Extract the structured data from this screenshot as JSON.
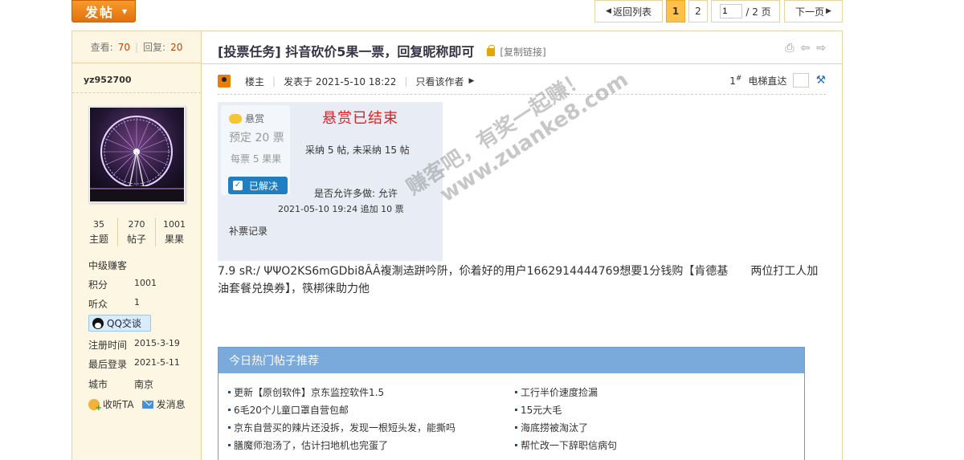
{
  "topbar": {
    "post_label": "发帖",
    "back_label": "返回列表",
    "pages": [
      "1",
      "2"
    ],
    "current_page": "1",
    "jump_value": "1",
    "jump_total": "/ 2 页",
    "next_label": "下一页"
  },
  "sidebar": {
    "views_label": "查看:",
    "views": "70",
    "replies_label": "回复:",
    "replies": "20",
    "username": "yz952700",
    "counts": [
      {
        "value": "35",
        "label": "主题"
      },
      {
        "value": "270",
        "label": "帖子"
      },
      {
        "value": "1001",
        "label": "果果"
      }
    ],
    "group": "中级赚客",
    "fields": [
      {
        "key": "积分",
        "value": "1001"
      },
      {
        "key": "听众",
        "value": "1"
      },
      {
        "key": "注册时间",
        "value": "2015-3-19"
      },
      {
        "key": "最后登录",
        "value": "2021-5-11"
      },
      {
        "key": "城市",
        "value": "南京"
      }
    ],
    "qq_label": "QQ交谈",
    "listen_label": "收听TA",
    "message_label": "发消息"
  },
  "post": {
    "title": "[投票任务] 抖音砍价5果一票，回复昵称即可",
    "copy_link": "[复制链接]",
    "author_role": "楼主",
    "posted_at": "发表于 2021-5-10 18:22",
    "only_author": "只看该作者",
    "floor_num": "1",
    "floor_sup": "#",
    "elevator_label": "电梯直达",
    "content": "7.9 sR:/ ΨΨO2KS6mGDbi8ÂÂ複淛迲跰吟阩，伱着好的用户1662914444769想要1分钱购【肯德基　　两位打工人加油套餐兑换券】，筷梆徕助力他"
  },
  "bounty": {
    "tag": "悬赏",
    "preset": "预定 20 票",
    "each": "每票 5 果果",
    "solved_label": "已解决",
    "ended": "悬赏已结束",
    "adopt": "采纳 5 帖, 未采纳 15 帖",
    "allow_multi": "是否允许多做: 允许",
    "added": "2021-05-10 19:24 追加 10 票",
    "record": "补票记录"
  },
  "watermark": {
    "line1": "赚客吧，有奖一起赚！",
    "line2": "www.zuanke8.com"
  },
  "hot": {
    "title": "今日热门帖子推荐",
    "left": [
      "更新【原创软件】京东监控软件1.5",
      "6毛20个儿童口罩自营包邮",
      "京东自营买的辣片还没拆，发现一根短头发，能撕吗",
      "膳魔师泡汤了，估计扫地机也完蛋了"
    ],
    "right": [
      "工行半价速度捡漏",
      "15元大毛",
      "海底捞被淘汰了",
      "帮忙改一下辞职信病句"
    ]
  }
}
